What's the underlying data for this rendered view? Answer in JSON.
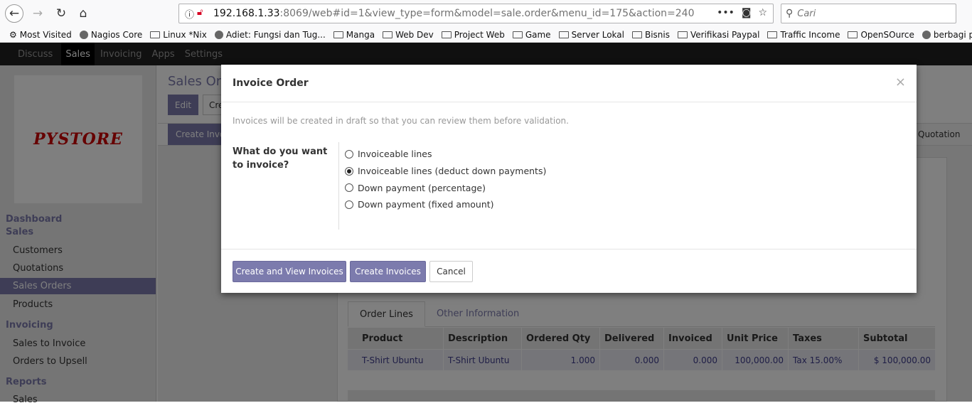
{
  "browser": {
    "url_host": "192.168.1.33",
    "url_rest": ":8069/web#id=1&view_type=form&model=sale.order&menu_id=175&action=240",
    "search_placeholder": "Cari",
    "bookmarks": [
      "Most Visited",
      "Nagios Core",
      "Linux *Nix",
      "Adiet: Fungsi dan Tug...",
      "Manga",
      "Web Dev",
      "Project Web",
      "Game",
      "Server Lokal",
      "Bisnis",
      "Verifikasi Paypal",
      "Traffic Income",
      "OpenSOurce",
      "berbagi pengalaman"
    ]
  },
  "topnav": [
    "Discuss",
    "Sales",
    "Invoicing",
    "Apps",
    "Settings"
  ],
  "sidebar": {
    "logo": "PYSTORE",
    "sections": {
      "dashboard": "Dashboard",
      "sales": "Sales",
      "invoicing": "Invoicing",
      "reports": "Reports"
    },
    "items": {
      "customers": "Customers",
      "quotations": "Quotations",
      "sales_orders": "Sales Orders",
      "products": "Products",
      "sales_to_invoice": "Sales to Invoice",
      "orders_to_upsell": "Orders to Upsell",
      "reports_sales": "Sales"
    }
  },
  "background": {
    "title": "Sales Ord",
    "edit": "Edit",
    "create": "Cre",
    "create_invoice": "Create Invoice",
    "quotation": "Quotation",
    "tabs": [
      "Order Lines",
      "Other Information"
    ],
    "table": {
      "headers": [
        "Product",
        "Description",
        "Ordered Qty",
        "Delivered",
        "Invoiced",
        "Unit Price",
        "Taxes",
        "Subtotal"
      ],
      "rows": [
        [
          "T-Shirt Ubuntu",
          "T-Shirt Ubuntu",
          "1.000",
          "0.000",
          "0.000",
          "100,000.00",
          "Tax 15.00%",
          "$ 100,000.00"
        ]
      ]
    }
  },
  "modal": {
    "title": "Invoice Order",
    "description": "Invoices will be created in draft so that you can review them before validation.",
    "question": "What do you want to invoice?",
    "options": [
      {
        "label": "Invoiceable lines",
        "checked": false
      },
      {
        "label": "Invoiceable lines (deduct down payments)",
        "checked": true
      },
      {
        "label": "Down payment (percentage)",
        "checked": false
      },
      {
        "label": "Down payment (fixed amount)",
        "checked": false
      }
    ],
    "buttons": {
      "create_view": "Create and View Invoices",
      "create": "Create Invoices",
      "cancel": "Cancel"
    },
    "close": "×"
  }
}
